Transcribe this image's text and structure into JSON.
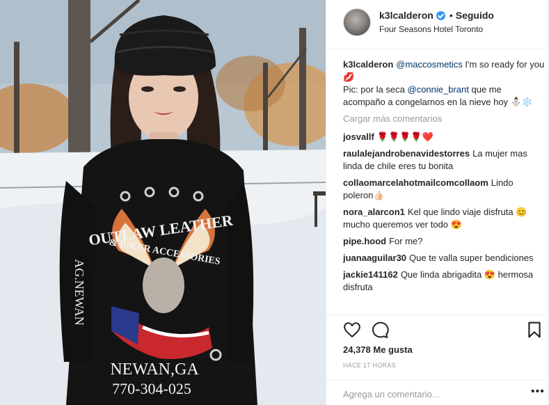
{
  "header": {
    "username": "k3lcalderon",
    "separator": "•",
    "follow_state": "Seguido",
    "location": "Four Seasons Hotel Toronto"
  },
  "caption": {
    "username": "k3lcalderon",
    "mention1": "@maccosmetics",
    "text1": " I'm so ready for you 💋",
    "text2": "Pic: por la seca ",
    "mention2": "@connie_brant",
    "text3": " que me acompaño a congelarnos en la nieve hoy ⛄❄️"
  },
  "load_more": "Cargar más comentarios",
  "comments": [
    {
      "user": "josvallf",
      "text": "🌹🌹🌹🌹❤️"
    },
    {
      "user": "raulalejandrobenavidestorres",
      "text": "La mujer mas linda de chile eres tu bonita"
    },
    {
      "user": "collaomarcelahotmailcomcollaom",
      "text": "Lindo poleron👍🏻"
    },
    {
      "user": "nora_alarcon1",
      "text": "Kel que lindo viaje disfruta 😊 mucho queremos ver todo 😍"
    },
    {
      "user": "pipe.hood",
      "text": "For me?"
    },
    {
      "user": "juanaaguilar30",
      "text": "Que te valla super bendiciones"
    },
    {
      "user": "jackie141162",
      "text": "Que linda abrigadita 😍 hermosa disfruta"
    }
  ],
  "actions": {
    "likes": "24,378 Me gusta",
    "time": "HACE 17 HORAS",
    "comment_placeholder": "Agrega un comentario...",
    "more": "•••"
  },
  "icons": {
    "like": "heart-icon",
    "comment": "comment-icon",
    "save": "bookmark-icon",
    "verified": "verified-badge-icon"
  },
  "photo": {
    "shirt_text1": "OUTLAW LEATHER",
    "shirt_text2": "& BIKER ACCESSORIES",
    "shirt_text3": "NEWAN,GA",
    "shirt_text4": "770-304-025",
    "sleeve_text": "AG.NEWAN"
  },
  "colors": {
    "link": "#003569",
    "muted": "#999999",
    "text": "#262626",
    "verified": "#3897f0"
  }
}
